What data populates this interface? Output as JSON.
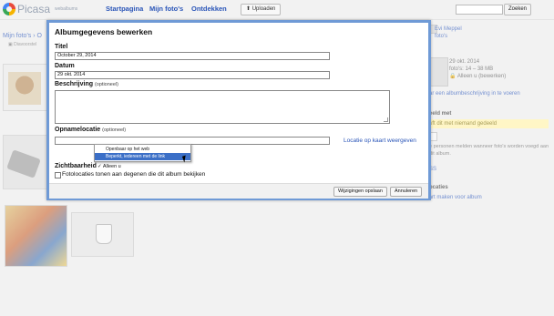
{
  "topbar": {
    "brand": "Picasa",
    "brand_sub": "webalbums",
    "tabs": [
      "Startpagina",
      "Mijn foto's",
      "Ontdekken"
    ],
    "upload_label": "Uploaden",
    "search_button": "Zoeken"
  },
  "main": {
    "breadcrumb": "Mijn foto's › O",
    "slideshow": "Diavoorstel"
  },
  "right_panel": {
    "owner_name": "Evi Meppel",
    "owner_sub": "foto's",
    "album_date": "29 okt. 2014",
    "album_count": "foto's: 14 – 38 MB",
    "album_visibility": "Alleen u (bewerken)",
    "description_link": "ar een albumbeschrijving in te voeren",
    "shared_heading": "eeld met",
    "not_shared": "wft dit met niemand gedeeld",
    "share_info": "e personen melden wanneer foto's worden\nvoegd aan dit album.",
    "rss_link": "SS",
    "locations_heading": "ocaties",
    "map_link": "Kaart maken voor album"
  },
  "dialog": {
    "title": "Albumgegevens bewerken",
    "title_label": "Titel",
    "title_value": "October 29, 2014",
    "date_label": "Datum",
    "date_value": "29 okt. 2014",
    "description_label": "Beschrijving",
    "description_optional": "(optioneel)",
    "location_label": "Opnamelocatie",
    "location_optional": "(optioneel)",
    "map_link": "Locatie op kaart weergeven",
    "visibility_label": "Zichtbaarheid",
    "visibility_value": "✓ Alleen u",
    "visibility_options": [
      "Openbaar op het web",
      "Beperkt, iedereen met de link"
    ],
    "photo_locations_label": "Fotolocaties tonen aan degenen die dit album bekijken",
    "save_button": "Wijzigingen opslaan",
    "cancel_button": "Annuleren"
  }
}
